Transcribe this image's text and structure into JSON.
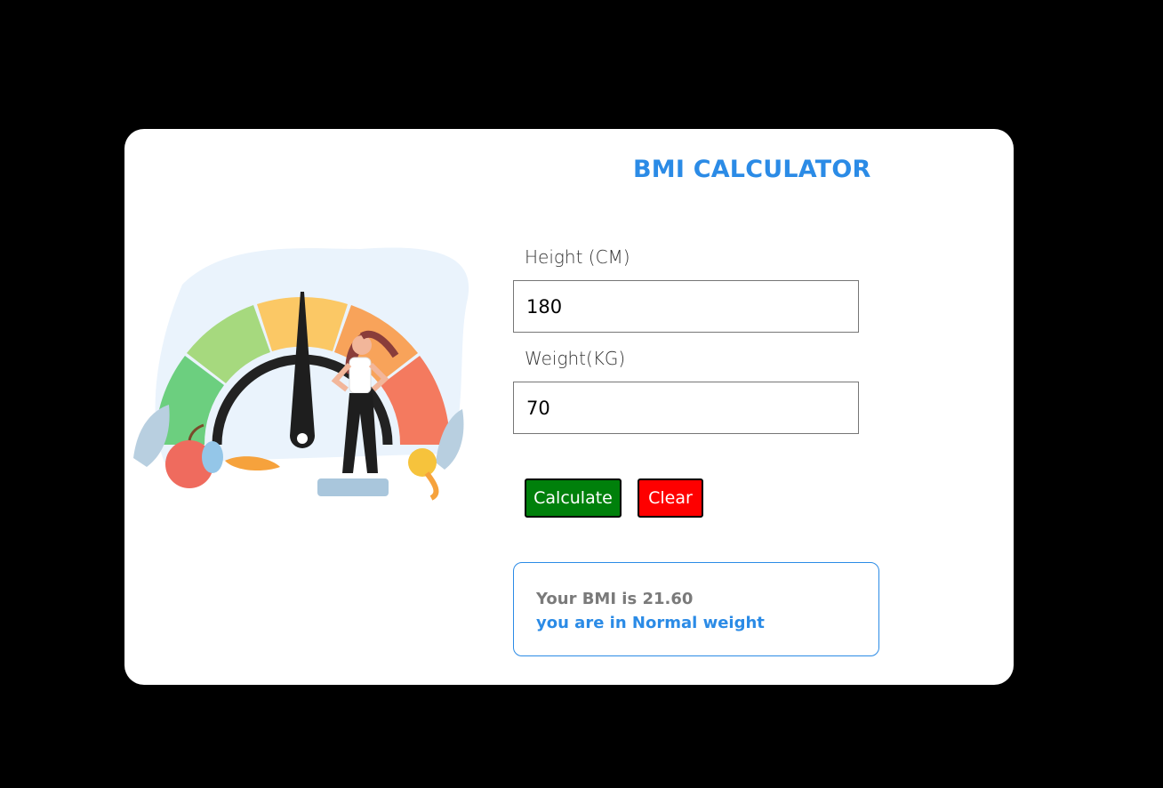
{
  "app": {
    "title": "BMI CALCULATOR"
  },
  "form": {
    "height_label": "Height (CM)",
    "height_value": "180",
    "weight_label": "Weight(KG)",
    "weight_value": "70",
    "calculate_label": "Calculate",
    "clear_label": "Clear"
  },
  "result": {
    "bmi_text": "Your BMI is 21.60",
    "category_text": "you are in Normal weight"
  },
  "illustration": {
    "icon": "bmi-gauge-illustration",
    "gauge_colors": [
      "#6ccf7f",
      "#a6d97e",
      "#fbc865",
      "#f8a35a",
      "#f47a5f"
    ]
  },
  "colors": {
    "accent": "#2b8be6",
    "calculate": "#00800b",
    "clear": "#fe0000",
    "background": "#000000",
    "card": "#ffffff"
  }
}
